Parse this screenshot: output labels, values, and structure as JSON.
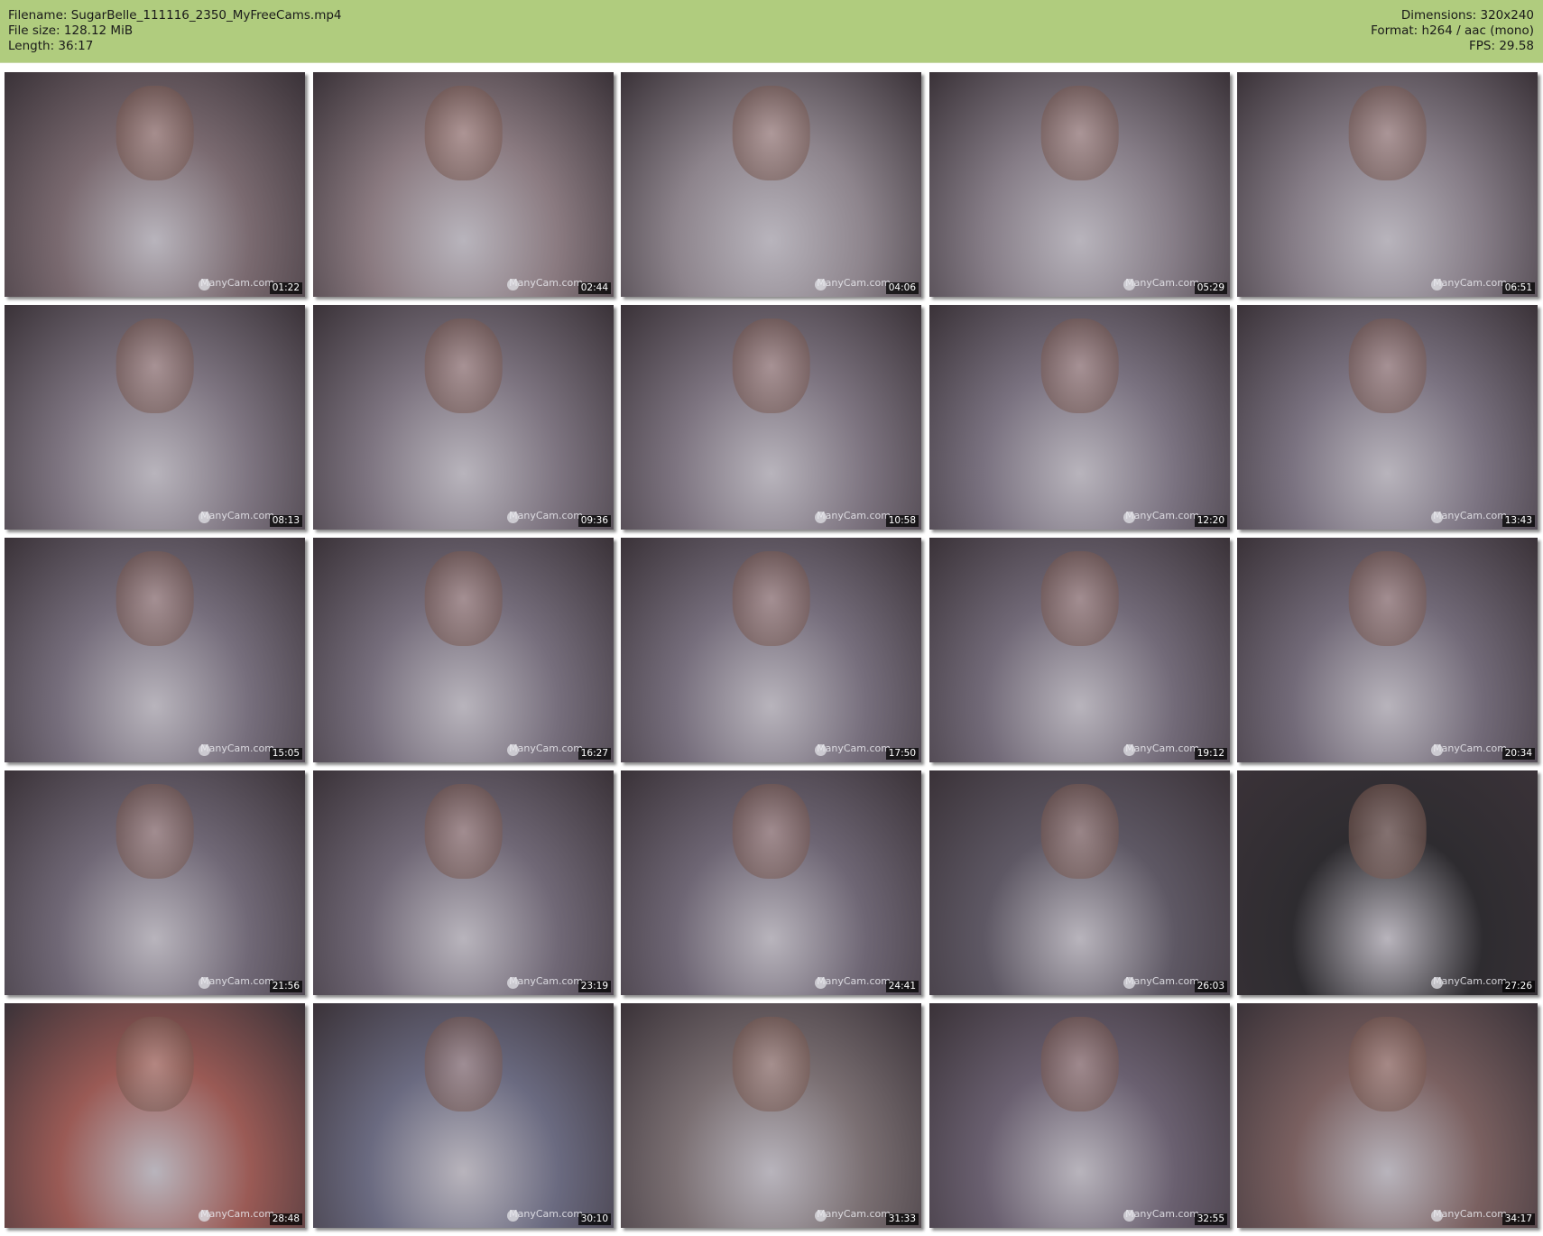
{
  "header": {
    "filename": "Filename: SugarBelle_111116_2350_MyFreeCams.mp4",
    "filesize": "File size: 128.12 MiB",
    "length": "Length: 36:17",
    "dimensions": "Dimensions: 320x240",
    "format": "Format: h264 / aac (mono)",
    "fps": "FPS: 29.58"
  },
  "colors": {
    "header_bg": "#b0cc7e"
  },
  "watermark": "ManyCam.com",
  "frames": [
    {
      "time": "01:22",
      "tone": "#7a6a70"
    },
    {
      "time": "02:44",
      "tone": "#8a7a80"
    },
    {
      "time": "04:06",
      "tone": "#8d848c"
    },
    {
      "time": "05:29",
      "tone": "#857c86"
    },
    {
      "time": "06:51",
      "tone": "#857c86"
    },
    {
      "time": "08:13",
      "tone": "#7d7480"
    },
    {
      "time": "09:36",
      "tone": "#7d7480"
    },
    {
      "time": "10:58",
      "tone": "#7d7480"
    },
    {
      "time": "12:20",
      "tone": "#7a7280"
    },
    {
      "time": "13:43",
      "tone": "#7a7280"
    },
    {
      "time": "15:05",
      "tone": "#766e7c"
    },
    {
      "time": "16:27",
      "tone": "#766e7c"
    },
    {
      "time": "17:50",
      "tone": "#766e7c"
    },
    {
      "time": "19:12",
      "tone": "#726a78"
    },
    {
      "time": "20:34",
      "tone": "#726a78"
    },
    {
      "time": "21:56",
      "tone": "#706876"
    },
    {
      "time": "23:19",
      "tone": "#706876"
    },
    {
      "time": "24:41",
      "tone": "#6e6674"
    },
    {
      "time": "26:03",
      "tone": "#5e5864"
    },
    {
      "time": "27:26",
      "tone": "#2e2c30"
    },
    {
      "time": "28:48",
      "tone": "#9a5a55"
    },
    {
      "time": "30:10",
      "tone": "#6a6a80"
    },
    {
      "time": "31:33",
      "tone": "#7a6f72"
    },
    {
      "time": "32:55",
      "tone": "#6a6070"
    },
    {
      "time": "34:17",
      "tone": "#7a6060"
    }
  ]
}
